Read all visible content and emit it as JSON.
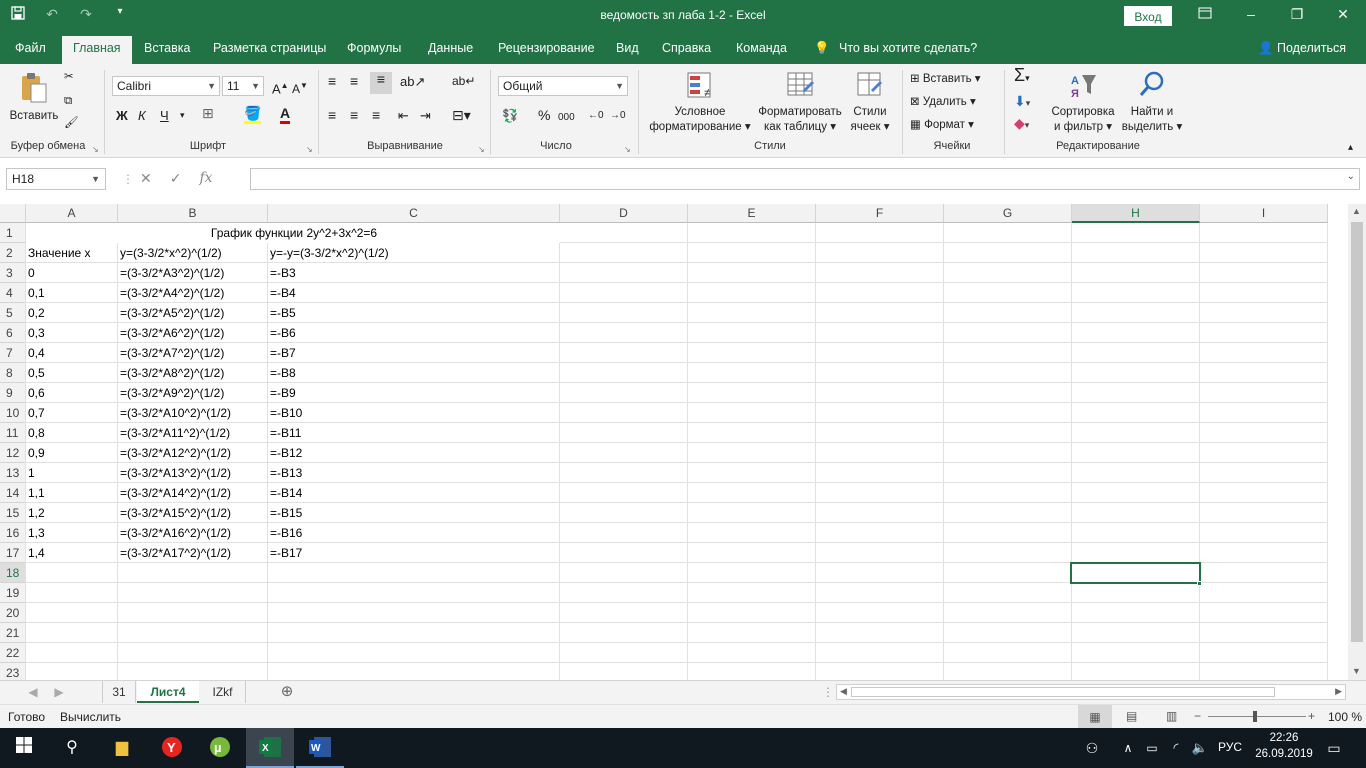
{
  "window": {
    "title": "ведомость зп лаба 1-2  -  Excel",
    "signin_label": "Вход",
    "minimize": "–",
    "restore": "❐",
    "close": "✕"
  },
  "ribbon_tabs": [
    "Файл",
    "Главная",
    "Вставка",
    "Разметка страницы",
    "Формулы",
    "Данные",
    "Рецензирование",
    "Вид",
    "Справка",
    "Команда"
  ],
  "tell_me": "Что вы хотите сделать?",
  "share": "Поделиться",
  "ribbon": {
    "clipboard": {
      "paste": "Вставить",
      "label": "Буфер обмена"
    },
    "font": {
      "name": "Calibri",
      "size": "11",
      "bold": "Ж",
      "italic": "К",
      "underline": "Ч",
      "label": "Шрифт"
    },
    "alignment": {
      "label": "Выравнивание"
    },
    "number": {
      "format": "Общий",
      "percent": "%",
      "thousands": "000",
      "label": "Число"
    },
    "styles": {
      "conditional_1": "Условное",
      "conditional_2": "форматирование",
      "table_1": "Форматировать",
      "table_2": "как таблицу",
      "cells_1": "Стили",
      "cells_2": "ячеек",
      "label": "Стили"
    },
    "cells": {
      "insert": "Вставить",
      "delete": "Удалить",
      "format": "Формат",
      "label": "Ячейки"
    },
    "editing": {
      "sort_1": "Сортировка",
      "sort_2": "и фильтр",
      "find_1": "Найти и",
      "find_2": "выделить",
      "label": "Редактирование"
    }
  },
  "formula_bar": {
    "name_box": "H18",
    "fx": "fx",
    "value": ""
  },
  "columns": [
    "A",
    "B",
    "C",
    "D",
    "E",
    "F",
    "G",
    "H",
    "I"
  ],
  "selected_column": "H",
  "selected_row": "18",
  "rows": [
    {
      "n": "1",
      "a": "",
      "b": "",
      "c": ""
    },
    {
      "n": "2",
      "a": "Значение x",
      "b": "y=(3-3/2*x^2)^(1/2)",
      "c": "y=-y=(3-3/2*x^2)^(1/2)"
    },
    {
      "n": "3",
      "a": "0",
      "b": "=(3-3/2*A3^2)^(1/2)",
      "c": "=-B3"
    },
    {
      "n": "4",
      "a": "0,1",
      "b": "=(3-3/2*A4^2)^(1/2)",
      "c": "=-B4"
    },
    {
      "n": "5",
      "a": "0,2",
      "b": "=(3-3/2*A5^2)^(1/2)",
      "c": "=-B5"
    },
    {
      "n": "6",
      "a": "0,3",
      "b": "=(3-3/2*A6^2)^(1/2)",
      "c": "=-B6"
    },
    {
      "n": "7",
      "a": "0,4",
      "b": "=(3-3/2*A7^2)^(1/2)",
      "c": "=-B7"
    },
    {
      "n": "8",
      "a": "0,5",
      "b": "=(3-3/2*A8^2)^(1/2)",
      "c": "=-B8"
    },
    {
      "n": "9",
      "a": "0,6",
      "b": "=(3-3/2*A9^2)^(1/2)",
      "c": "=-B9"
    },
    {
      "n": "10",
      "a": "0,7",
      "b": "=(3-3/2*A10^2)^(1/2)",
      "c": "=-B10"
    },
    {
      "n": "11",
      "a": "0,8",
      "b": "=(3-3/2*A11^2)^(1/2)",
      "c": "=-B11"
    },
    {
      "n": "12",
      "a": "0,9",
      "b": "=(3-3/2*A12^2)^(1/2)",
      "c": "=-B12"
    },
    {
      "n": "13",
      "a": "1",
      "b": "=(3-3/2*A13^2)^(1/2)",
      "c": "=-B13"
    },
    {
      "n": "14",
      "a": "1,1",
      "b": "=(3-3/2*A14^2)^(1/2)",
      "c": "=-B14"
    },
    {
      "n": "15",
      "a": "1,2",
      "b": "=(3-3/2*A15^2)^(1/2)",
      "c": "=-B15"
    },
    {
      "n": "16",
      "a": "1,3",
      "b": "=(3-3/2*A16^2)^(1/2)",
      "c": "=-B16"
    },
    {
      "n": "17",
      "a": "1,4",
      "b": "=(3-3/2*A17^2)^(1/2)",
      "c": "=-B17"
    },
    {
      "n": "18",
      "a": "",
      "b": "",
      "c": ""
    },
    {
      "n": "19",
      "a": "",
      "b": "",
      "c": ""
    },
    {
      "n": "20",
      "a": "",
      "b": "",
      "c": ""
    },
    {
      "n": "21",
      "a": "",
      "b": "",
      "c": ""
    },
    {
      "n": "22",
      "a": "",
      "b": "",
      "c": ""
    },
    {
      "n": "23",
      "a": "",
      "b": "",
      "c": ""
    }
  ],
  "merged_title": "График функции 2y^2+3x^2=6",
  "sheets": [
    "31",
    "Лист4",
    "IZkf"
  ],
  "active_sheet": "Лист4",
  "status": {
    "ready": "Готово",
    "calc": "Вычислить",
    "zoom": "100 %"
  },
  "taskbar": {
    "lang": "РУС",
    "time": "22:26",
    "date": "26.09.2019"
  },
  "colors": {
    "accent": "#217346",
    "taskbar": "#101820"
  }
}
